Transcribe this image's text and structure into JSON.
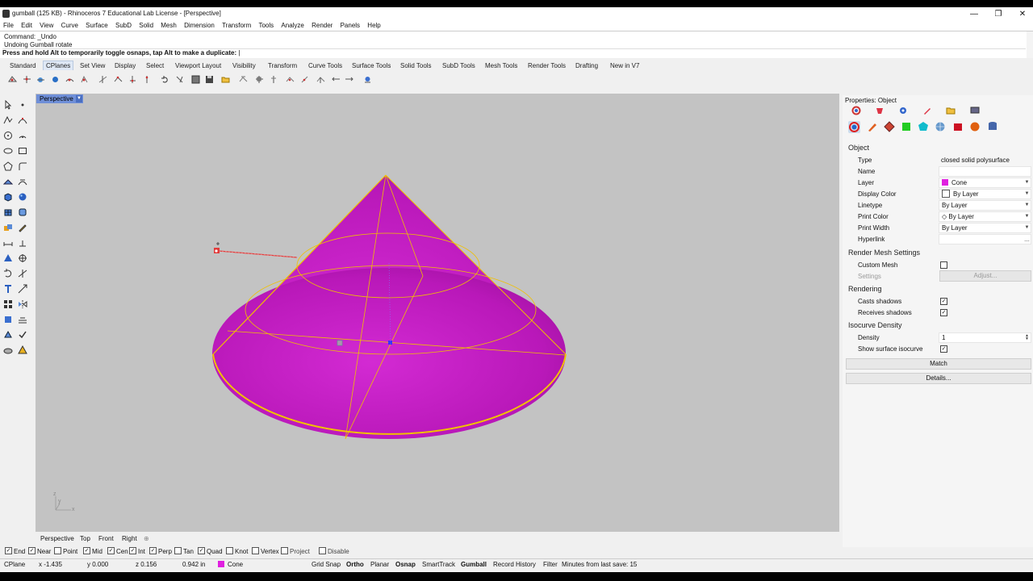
{
  "window": {
    "title": "gumball (125 KB) - Rhinoceros 7 Educational Lab License - [Perspective]",
    "minimize": "—",
    "maximize": "❐",
    "close": "✕"
  },
  "menu": [
    "File",
    "Edit",
    "View",
    "Curve",
    "Surface",
    "SubD",
    "Solid",
    "Mesh",
    "Dimension",
    "Transform",
    "Tools",
    "Analyze",
    "Render",
    "Panels",
    "Help"
  ],
  "command": {
    "history": [
      "Command: _Undo",
      "Undoing Gumball rotate"
    ],
    "prompt": "Press and hold Alt to temporarily toggle osnaps, tap Alt to make a duplicate:"
  },
  "toolbar_tabs": [
    "Standard",
    "CPlanes",
    "Set View",
    "Display",
    "Select",
    "Viewport Layout",
    "Visibility",
    "Transform",
    "Curve Tools",
    "Surface Tools",
    "Solid Tools",
    "SubD Tools",
    "Mesh Tools",
    "Render Tools",
    "Drafting",
    "New in V7"
  ],
  "active_tab": "CPlanes",
  "viewport": {
    "label": "Perspective",
    "axis_y": "y",
    "axis_x": "x",
    "axis_z": "z",
    "tabs": [
      "Perspective",
      "Top",
      "Front",
      "Right"
    ],
    "add_tab": "⊕",
    "object_color": "#c722c7",
    "edge_color": "#f0c000"
  },
  "osnaps": [
    {
      "label": "End",
      "checked": true
    },
    {
      "label": "Near",
      "checked": true
    },
    {
      "label": "Point",
      "checked": false
    },
    {
      "label": "Mid",
      "checked": true
    },
    {
      "label": "Cen",
      "checked": true
    },
    {
      "label": "Int",
      "checked": true
    },
    {
      "label": "Perp",
      "checked": true
    },
    {
      "label": "Tan",
      "checked": false
    },
    {
      "label": "Quad",
      "checked": true
    },
    {
      "label": "Knot",
      "checked": false
    },
    {
      "label": "Vertex",
      "checked": false
    },
    {
      "label": "Project",
      "checked": false
    },
    {
      "label": "Disable",
      "checked": false
    }
  ],
  "status": {
    "cplane": "CPlane",
    "x": "x -1.435",
    "y": "y 0.000",
    "z": "z 0.156",
    "dist": "0.942 in",
    "layer": "Cone",
    "layer_color": "#e020e0",
    "grid_snap": "Grid Snap",
    "ortho": "Ortho",
    "planar": "Planar",
    "osnap": "Osnap",
    "smarttrack": "SmartTrack",
    "gumball": "Gumball",
    "record_history": "Record History",
    "filter": "Filter",
    "save_info": "Minutes from last save: 15"
  },
  "properties": {
    "title": "Properties: Object",
    "section_object": "Object",
    "type_label": "Type",
    "type_value": "closed solid polysurface",
    "name_label": "Name",
    "name_value": "",
    "layer_label": "Layer",
    "layer_value": "Cone",
    "display_color_label": "Display Color",
    "display_color_value": "By Layer",
    "linetype_label": "Linetype",
    "linetype_value": "By Layer",
    "print_color_label": "Print Color",
    "print_color_value": "By Layer",
    "print_width_label": "Print Width",
    "print_width_value": "By Layer",
    "hyperlink_label": "Hyperlink",
    "hyperlink_btn": "...",
    "section_rms": "Render Mesh Settings",
    "custom_mesh_label": "Custom Mesh",
    "custom_mesh": false,
    "settings_label": "Settings",
    "adjust_btn": "Adjust...",
    "section_rendering": "Rendering",
    "casts_shadows_label": "Casts shadows",
    "casts_shadows": true,
    "receives_shadows_label": "Receives shadows",
    "receives_shadows": true,
    "section_isocurve": "Isocurve Density",
    "density_label": "Density",
    "density_value": "1",
    "show_iso_label": "Show surface isocurve",
    "show_iso": true,
    "match_btn": "Match",
    "details_btn": "Details..."
  }
}
